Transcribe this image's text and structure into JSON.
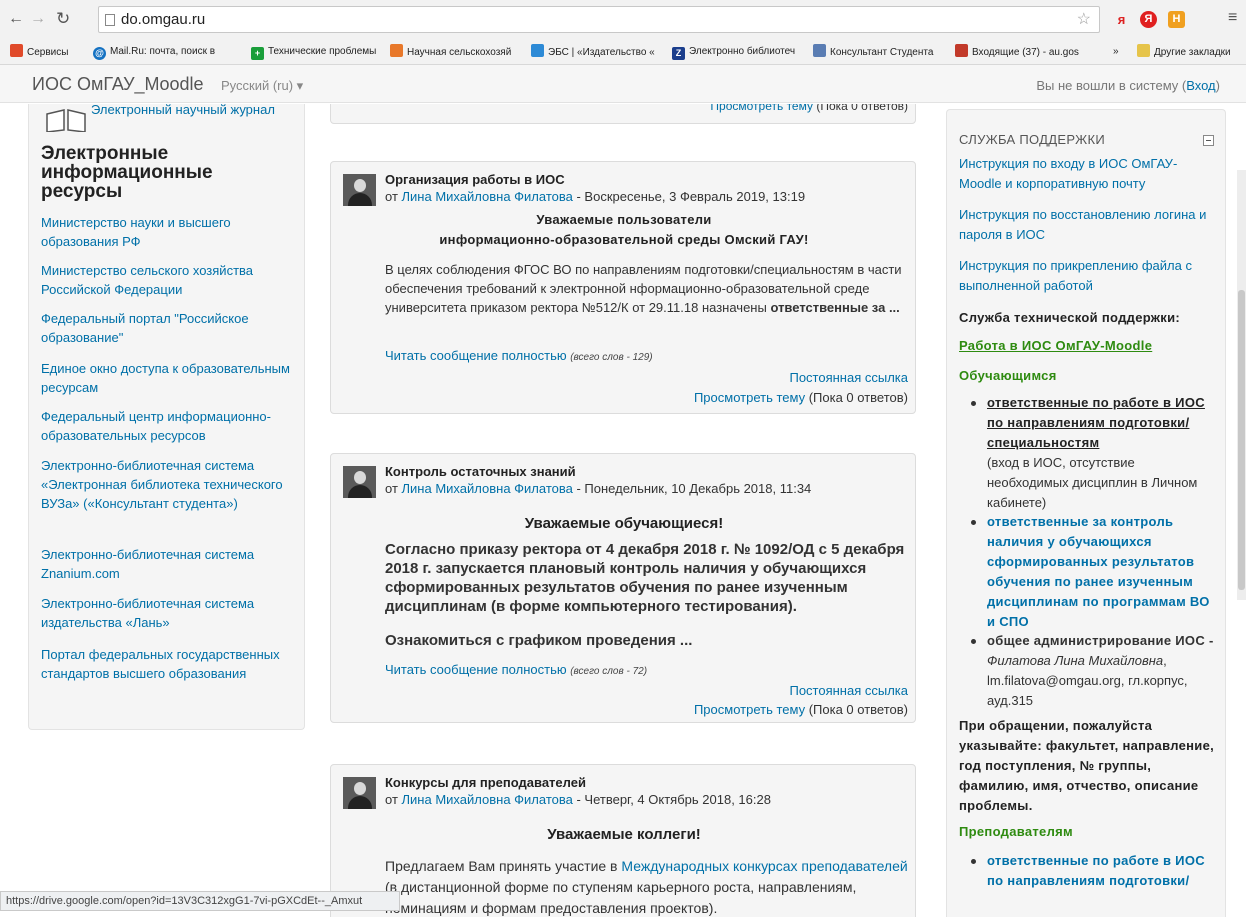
{
  "browser": {
    "url": "do.omgau.ru",
    "bookmarks": [
      {
        "label": "Сервисы",
        "color": "#e04a2a"
      },
      {
        "label": "Mail.Ru: почта, поиск в",
        "color": "#1572c2"
      },
      {
        "label": "Технические проблемы",
        "color": "#1a9e3a"
      },
      {
        "label": "Научная сельскохозяй",
        "color": "#e8782a"
      },
      {
        "label": "ЭБС | «Издательство «",
        "color": "#2d8ad6"
      },
      {
        "label": "Электронно библиотеч",
        "color": "#1b3e8c"
      },
      {
        "label": "Консультант Студента",
        "color": "#5a7db3"
      },
      {
        "label": "Входящие (37) - au.gos",
        "color": "#c23a2a"
      },
      {
        "label": "»",
        "color": ""
      },
      {
        "label": "Другие закладки",
        "color": "#e6c44a"
      }
    ],
    "status_url": "https://drive.google.com/open?id=13V3C312xgG1-7vi-pGXCdEt--_Amxut"
  },
  "navbar": {
    "brand": "ИОС ОмГАУ_Moodle",
    "language": "Русский (ru) ▾",
    "login_text": "Вы не вошли в систему (",
    "login_link": "Вход",
    "login_close": ")"
  },
  "left": {
    "top_link": "Электронный научный журнал",
    "heading": "Электронные информационные ресурсы",
    "links": [
      "Министерство науки и высшего образования РФ",
      "Министерство сельского хозяйства Российской Федерации",
      "Федеральный портал \"Российское образование\"",
      "Единое окно доступа к образовательным ресурсам",
      "Федеральный центр информационно-образовательных ресурсов",
      "Электронно-библиотечная система «Электронная библиотека технического ВУЗа» («Консультант студента»)",
      "Электронно-библиотечная система Znanium.com",
      "Электронно-библиотечная система издательства «Лань»",
      "Портал федеральных государственных стандартов высшего образования"
    ]
  },
  "posts": {
    "prev_view": "Просмотреть тему",
    "prev_count": " (Пока 0 ответов)",
    "read_more": "Читать сообщение полностью",
    "permalink": "Постоянная ссылка",
    "view_topic": "Просмотреть тему",
    "reply_count": " (Пока 0 ответов)",
    "by": "от ",
    "author": "Лина Михайловна Филатова",
    "p1": {
      "title": "Организация работы в ИОС",
      "date": " - Воскресенье, 3 Февраль 2019, 13:19",
      "center1": "Уважаемые пользователи",
      "center2": "информационно-образовательной среды Омский ГАУ!",
      "body": "В целях соблюдения ФГОС ВО по направлениям подготовки/специальностям в части обеспечения требований к электронной нформационно-образовательной среде университета приказом ректора №512/К от 29.11.18 назначены ",
      "body_bold": "ответственные за ...",
      "words": "(всего слов - 129)"
    },
    "p2": {
      "title": "Контроль остаточных знаний",
      "date": " - Понедельник, 10 Декабрь 2018, 11:34",
      "center": "Уважаемые обучающиеся!",
      "body": "Согласно приказу ректора от 4 декабря 2018 г. № 1092/ОД с 5 декабря 2018 г. запускается плановый контроль наличия у обучающихся сформированных результатов обучения по ранее изученным дисциплинам (в форме компьютерного тестирования).",
      "body2": "Ознакомиться с графиком проведения ...",
      "words": "(всего слов - 72)"
    },
    "p3": {
      "title": "Конкурсы для преподавателей",
      "date": " - Четверг, 4 Октябрь 2018, 16:28",
      "center": "Уважаемые коллеги!",
      "body_a": "Предлагаем Вам принять участие в ",
      "body_link": "Международных конкурсах преподавателей",
      "body_b": " (в дистанционной форме по ступеням карьерного роста, направлениям, номинациям и формам предоставления проектов)."
    }
  },
  "right": {
    "header": "СЛУЖБА ПОДДЕРЖКИ",
    "links": [
      "Инструкция по входу в ИОС ОмГАУ-Moodle и корпоративную почту",
      "Инструкция по восстановлению логина и пароля в ИОС",
      "Инструкция по прикреплению файла с выполненной работой"
    ],
    "support_title": "Служба технической поддержки:",
    "work_link": "Работа в ИОС ОмГАУ-Moodle",
    "students": "Обучающимся",
    "s_item1_link": "ответственные по работе в ИОС по направлениям подготовки/специальностям",
    "s_item1_text": "(вход в ИОС, отсутствие необходимых дисциплин в Личном кабинете)",
    "s_item2": "ответственные за контроль наличия у обучающихся сформированных результатов обучения по ранее изученным дисциплинам  по программам ВО и СПО",
    "s_item3_bold": "общее администрирование ИОС -",
    "s_item3_italic": " Филатова Лина Михайловна",
    "s_item3_text": ", lm.filatova@omgau.org, гл.корпус, ауд.315",
    "appeal": "При обращении, пожалуйста указывайте: факультет, направление, год поступления, № группы, фамилию, имя, отчество, описание проблемы.",
    "teachers": "Преподавателям",
    "t_item1": "ответственные по работе в ИОС по направлениям подготовки/"
  }
}
